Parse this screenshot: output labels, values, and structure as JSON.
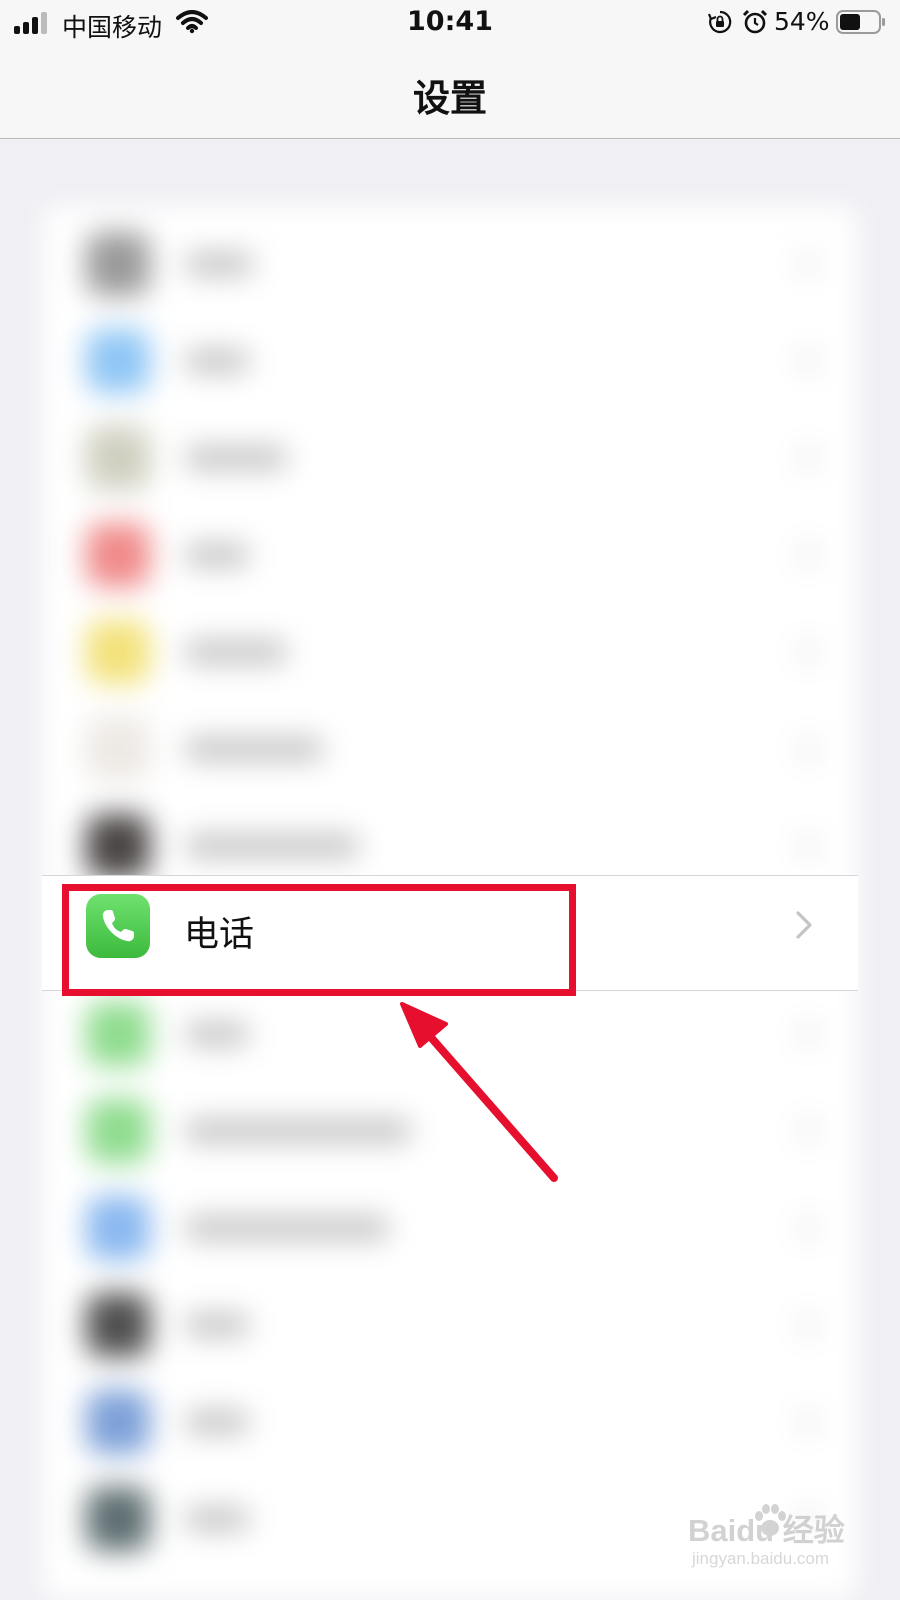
{
  "status_bar": {
    "carrier": "中国移动",
    "time": "10:41",
    "battery_percent": "54%",
    "battery_level": 0.54,
    "signal_bars": 3,
    "icons": [
      "signal-icon",
      "wifi-icon",
      "rotation-lock-icon",
      "alarm-icon",
      "battery-icon"
    ]
  },
  "nav": {
    "title": "设置"
  },
  "settings_list": {
    "highlighted_item": {
      "label": "电话",
      "icon": "phone-icon",
      "icon_color": "#4cd964"
    },
    "blurred_icon_colors": [
      "#9a9a9a",
      "#8fc6f5",
      "#cfcfc0",
      "#f08a8a",
      "#f3e27a",
      "#ede9e4",
      "#4a4545",
      "#8fdc8f",
      "#8fdc8f",
      "#8ab8f0",
      "#4f4f4f",
      "#7ca0d8",
      "#5e6e72"
    ]
  },
  "annotation": {
    "highlight_color": "#e60f2d"
  },
  "watermark": {
    "logo_text": "Baidu 经验",
    "url": "jingyan.baidu.com"
  }
}
